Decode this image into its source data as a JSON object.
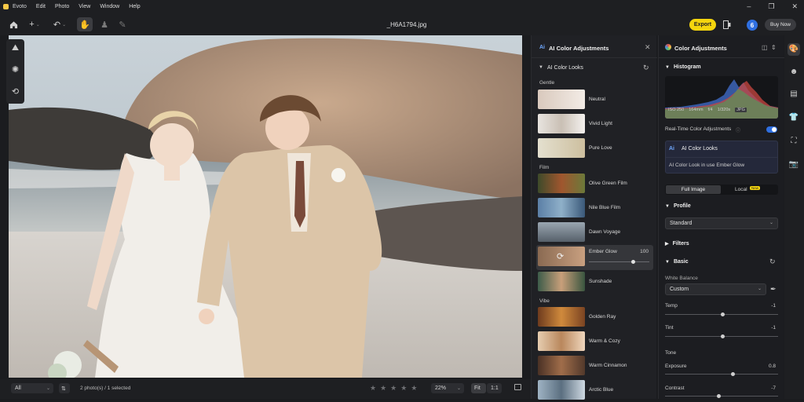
{
  "app": {
    "title": "Evoto",
    "menu": [
      "Edit",
      "Photo",
      "View",
      "Window",
      "Help"
    ],
    "filename": "_H6A1794.jpg"
  },
  "toolbar": {
    "export": "Export",
    "count": "6",
    "buy": "Buy Now"
  },
  "bottom": {
    "filter": "All",
    "status": "2 photo(s) / 1 selected",
    "zoom": "22%",
    "fit": "Fit",
    "one_to_one": "1:1",
    "stars": [
      "★",
      "★",
      "★",
      "★",
      "★"
    ]
  },
  "looks_panel": {
    "title": "AI Color Adjustments",
    "subtitle": "AI Color Looks",
    "sections": [
      {
        "label": "Gentle",
        "items": [
          "Neutral",
          "Vivid Light",
          "Pure Love"
        ]
      },
      {
        "label": "Film",
        "items": [
          "Olive Green Film",
          "Nile Blue Film",
          "Dawn Voyage",
          "Ember Glow",
          "Sunshade"
        ]
      },
      {
        "label": "Vibe",
        "items": [
          "Golden Ray",
          "Warm & Cozy",
          "Warm Cinnamon",
          "Arctic Blue"
        ]
      }
    ],
    "selected_value": "100",
    "selected_level": 0.7
  },
  "adjust_panel": {
    "title": "Color Adjustments",
    "histogram": {
      "label": "Histogram",
      "iso": "ISO 250",
      "focal": "164mm",
      "aperture": "f/4",
      "shutter": "1/320s",
      "format": "JPG"
    },
    "realtime": "Real-Time Color Adjustments",
    "ai_card": {
      "title": "AI Color Looks",
      "desc": "AI Color Look in use Ember Glow"
    },
    "tabs": {
      "full": "Full Image",
      "local": "Local",
      "new_badge": "New"
    },
    "profile": {
      "label": "Profile",
      "value": "Standard"
    },
    "filters": "Filters",
    "basic": "Basic",
    "white_balance": {
      "label": "White Balance",
      "value": "Custom"
    },
    "temp": {
      "label": "Temp",
      "value": "-1",
      "level": 0.49
    },
    "tint": {
      "label": "Tint",
      "value": "-1",
      "level": 0.49
    },
    "tone": "Tone",
    "exposure": {
      "label": "Exposure",
      "value": "0.8",
      "level": 0.58
    },
    "contrast": {
      "label": "Contrast",
      "value": "-7",
      "level": 0.46
    }
  },
  "colors": {
    "accent": "#2f6fe0",
    "export": "#f5d50e",
    "panel": "#202125"
  }
}
